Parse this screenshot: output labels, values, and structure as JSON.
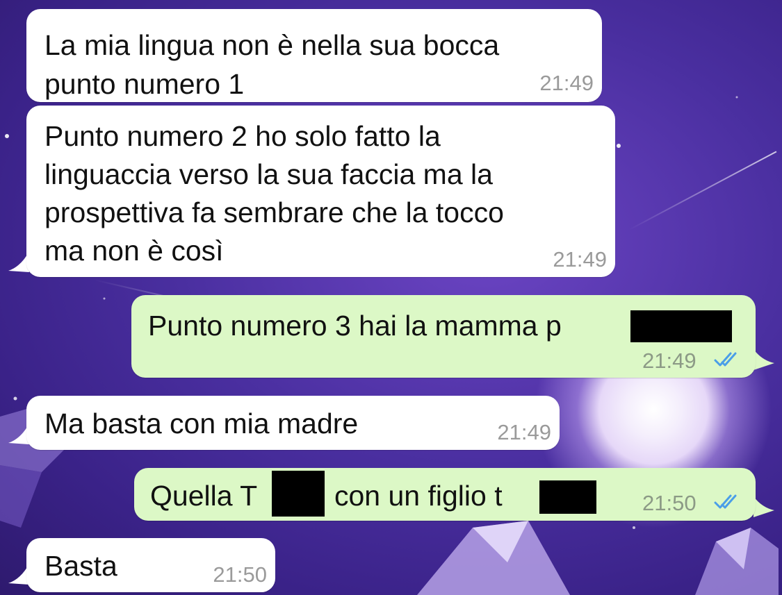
{
  "messages": [
    {
      "direction": "incoming",
      "lines": [
        "La mia lingua non è nella sua bocca",
        "punto numero 1"
      ],
      "time": "21:49"
    },
    {
      "direction": "incoming",
      "lines": [
        "Punto numero 2 ho solo fatto la",
        "linguaccia verso la sua faccia ma la",
        "prospettiva fa sembrare che la tocco",
        "ma non è così"
      ],
      "time": "21:49"
    },
    {
      "direction": "outgoing",
      "text": "Punto numero 3 hai la mamma p",
      "time": "21:49",
      "status": "read-double-check-icon"
    },
    {
      "direction": "incoming",
      "text": "Ma basta con mia madre",
      "time": "21:49"
    },
    {
      "direction": "outgoing",
      "parts": [
        "Quella T",
        "con un figlio t"
      ],
      "time": "21:50",
      "status": "read-double-check-icon"
    },
    {
      "direction": "incoming",
      "text": "Basta",
      "time": "21:50"
    }
  ],
  "colors": {
    "incoming_bubble": "#ffffff",
    "outgoing_bubble": "#dcf8c6",
    "read_ticks": "#4a9ee8",
    "wallpaper": "#4a2fa0"
  }
}
